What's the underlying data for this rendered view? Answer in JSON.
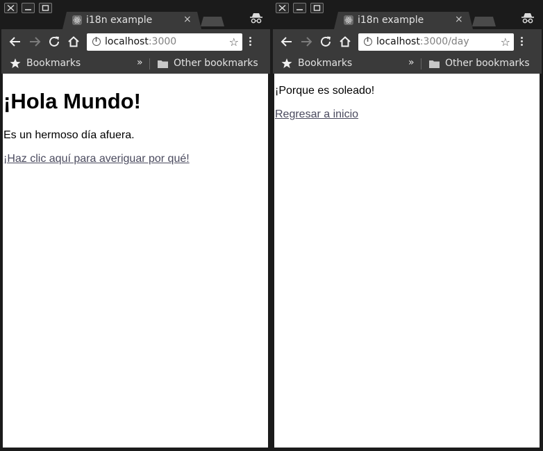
{
  "left_window": {
    "tab": {
      "title": "i18n example",
      "close": "×"
    },
    "omnibox": {
      "host": "localhost",
      "path": ":3000"
    },
    "bookmarks": {
      "label": "Bookmarks",
      "overflow": "»",
      "other": "Other bookmarks"
    },
    "page": {
      "heading": "¡Hola Mundo!",
      "paragraph": "Es un hermoso día afuera.",
      "link": "¡Haz clic aquí para averiguar por qué!"
    }
  },
  "right_window": {
    "tab": {
      "title": "i18n example",
      "close": "×"
    },
    "omnibox": {
      "host": "localhost",
      "path": ":3000/day"
    },
    "bookmarks": {
      "label": "Bookmarks",
      "overflow": "»",
      "other": "Other bookmarks"
    },
    "page": {
      "paragraph": "¡Porque es soleado!",
      "link": "Regresar a inicio"
    }
  },
  "icons": {
    "window_controls": [
      "close-icon",
      "minimize-icon",
      "maximize-icon"
    ],
    "toolbar": [
      "back-arrow-icon",
      "forward-arrow-icon",
      "reload-icon",
      "home-icon",
      "info-icon",
      "star-outline-icon",
      "menu-dots-icon"
    ],
    "bookmarks": [
      "star-icon",
      "folder-icon"
    ],
    "tab": [
      "react-favicon-icon",
      "incognito-icon"
    ]
  },
  "colors": {
    "chrome_dark": "#1b1b1b",
    "toolbar": "#3a3a3a",
    "link": "#4a4a5e",
    "content_bg": "#ffffff"
  }
}
